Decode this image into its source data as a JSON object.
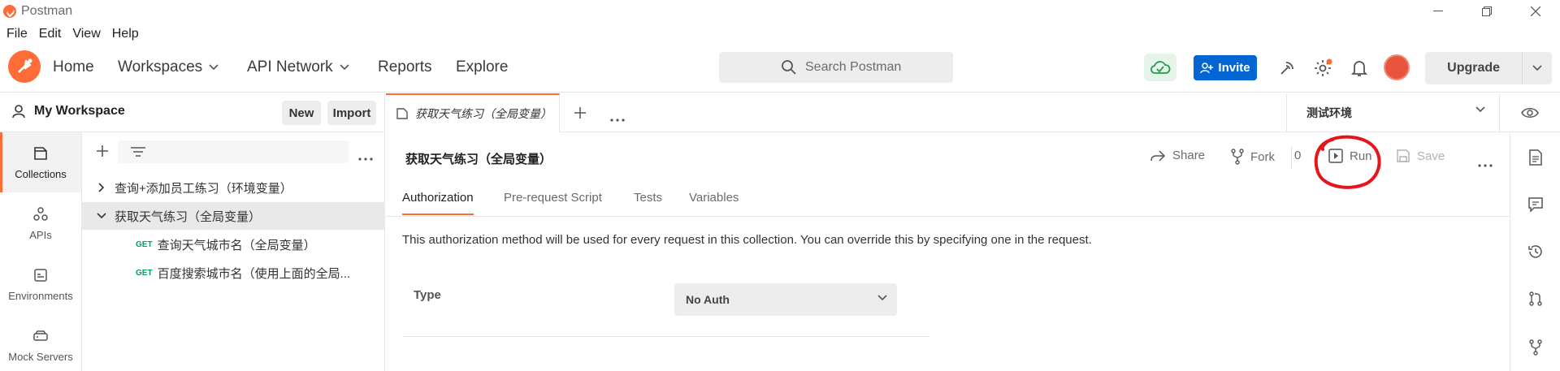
{
  "titlebar": {
    "title": "Postman"
  },
  "menu": [
    "File",
    "Edit",
    "View",
    "Help"
  ],
  "header": {
    "nav": [
      "Home",
      "Workspaces",
      "API Network",
      "Reports",
      "Explore"
    ],
    "search_placeholder": "Search Postman",
    "invite_label": "Invite",
    "upgrade_label": "Upgrade"
  },
  "workspace": {
    "name": "My Workspace",
    "new_label": "New",
    "import_label": "Import"
  },
  "rail": [
    {
      "label": "Collections",
      "icon": "collections-icon"
    },
    {
      "label": "APIs",
      "icon": "apis-icon"
    },
    {
      "label": "Environments",
      "icon": "environments-icon"
    },
    {
      "label": "Mock Servers",
      "icon": "mock-servers-icon"
    }
  ],
  "tree": {
    "items": [
      {
        "label": "查询+添加员工练习（环境变量）",
        "expanded": false
      },
      {
        "label": "获取天气练习（全局变量）",
        "expanded": true,
        "selected": true
      }
    ],
    "requests": [
      {
        "method": "GET",
        "label": "查询天气城市名（全局变量）"
      },
      {
        "method": "GET",
        "label": "百度搜索城市名（使用上面的全局..."
      }
    ]
  },
  "tab": {
    "label": "获取天气练习（全局变量）"
  },
  "environment": {
    "selected": "测试环境"
  },
  "main": {
    "title": "获取天气练习（全局变量）",
    "actions": {
      "share": "Share",
      "fork": "Fork",
      "fork_count": "0",
      "run": "Run",
      "save": "Save"
    },
    "subtabs": [
      "Authorization",
      "Pre-request Script",
      "Tests",
      "Variables"
    ],
    "auth_description": "This authorization method will be used for every request in this collection. You can override this by specifying one in the request.",
    "type_label": "Type",
    "auth_type": "No Auth"
  },
  "colors": {
    "accent": "#ff6c37",
    "invite": "#0265d2",
    "annotation": "#e8141b",
    "get": "#0a9c5c"
  }
}
